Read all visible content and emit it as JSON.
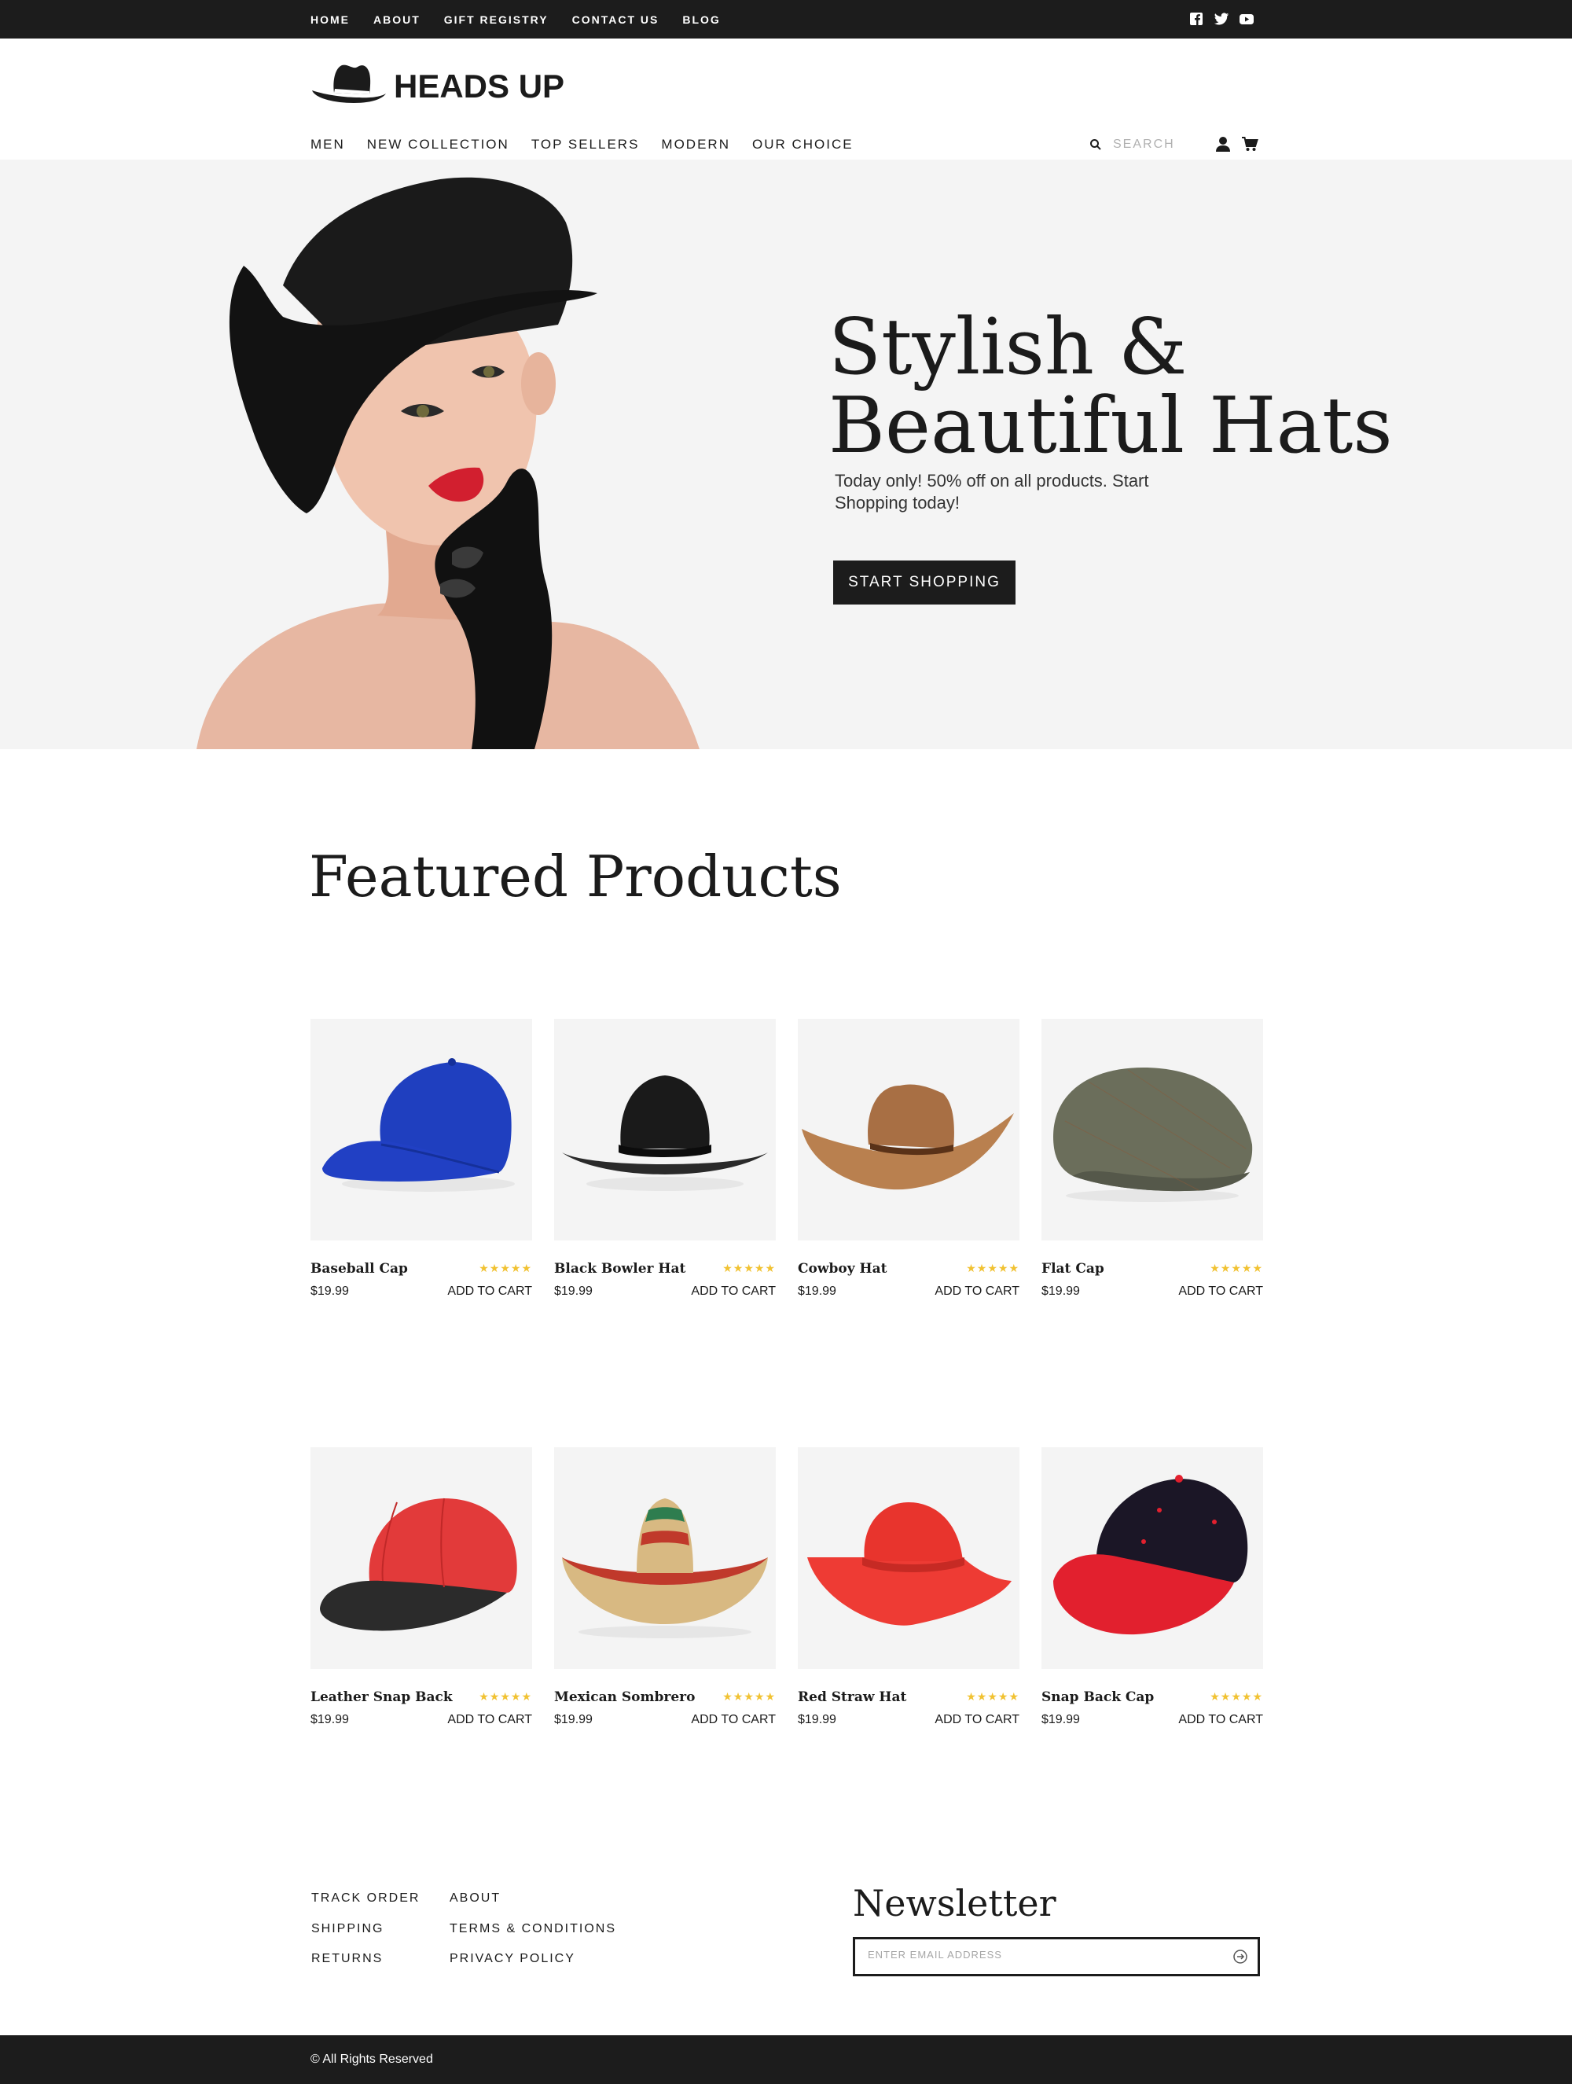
{
  "topbar": {
    "links": [
      "HOME",
      "ABOUT",
      "GIFT REGISTRY",
      "CONTACT US",
      "BLOG"
    ],
    "social_icons": [
      "facebook-icon",
      "twitter-icon",
      "youtube-icon"
    ]
  },
  "header": {
    "logo_text": "HEADS UP",
    "nav": [
      "MEN",
      "NEW COLLECTION",
      "TOP SELLERS",
      "MODERN",
      "OUR CHOICE"
    ],
    "search_placeholder": "SEARCH",
    "icons": [
      "user-icon",
      "cart-icon"
    ]
  },
  "hero": {
    "title_line1": "Stylish &",
    "title_line2": "Beautiful Hats",
    "subtitle": "Today only! 50% off on  all products. Start Shopping today!",
    "button_label": "START SHOPPING"
  },
  "featured": {
    "title": "Featured Products",
    "products": [
      {
        "name": "Baseball Cap",
        "price": "$19.99",
        "rating": 5,
        "stars": "★★★★★",
        "cart_label": "ADD TO CART",
        "color": "#1f3fbf"
      },
      {
        "name": "Black Bowler Hat",
        "price": "$19.99",
        "rating": 5,
        "stars": "★★★★★",
        "cart_label": "ADD TO CART",
        "color": "#1a1a1a"
      },
      {
        "name": "Cowboy Hat",
        "price": "$19.99",
        "rating": 5,
        "stars": "★★★★★",
        "cart_label": "ADD TO CART",
        "color": "#b9804f"
      },
      {
        "name": "Flat Cap",
        "price": "$19.99",
        "rating": 5,
        "stars": "★★★★★",
        "cart_label": "ADD TO CART",
        "color": "#6b6e5b"
      },
      {
        "name": "Leather Snap Back",
        "price": "$19.99",
        "rating": 5,
        "stars": "★★★★★",
        "cart_label": "ADD TO CART",
        "color": "#e23a3a"
      },
      {
        "name": "Mexican Sombrero",
        "price": "$19.99",
        "rating": 5,
        "stars": "★★★★★",
        "cart_label": "ADD TO CART",
        "color": "#d8b982"
      },
      {
        "name": "Red Straw Hat",
        "price": "$19.99",
        "rating": 5,
        "stars": "★★★★★",
        "cart_label": "ADD TO CART",
        "color": "#ee3b34"
      },
      {
        "name": "Snap Back Cap",
        "price": "$19.99",
        "rating": 5,
        "stars": "★★★★★",
        "cart_label": "ADD TO CART",
        "color": "#1b1626"
      }
    ]
  },
  "footer": {
    "col1": [
      "TRACK ORDER",
      "SHIPPING",
      "RETURNS"
    ],
    "col2": [
      "ABOUT",
      "TERMS & CONDITIONS",
      "PRIVACY POLICY"
    ],
    "newsletter_title": "Newsletter",
    "email_placeholder": "ENTER EMAIL ADDRESS",
    "copyright": "© All Rights Reserved"
  },
  "colors": {
    "dark": "#1c1c1c",
    "light_bg": "#f4f4f4",
    "star": "#f1c232"
  }
}
